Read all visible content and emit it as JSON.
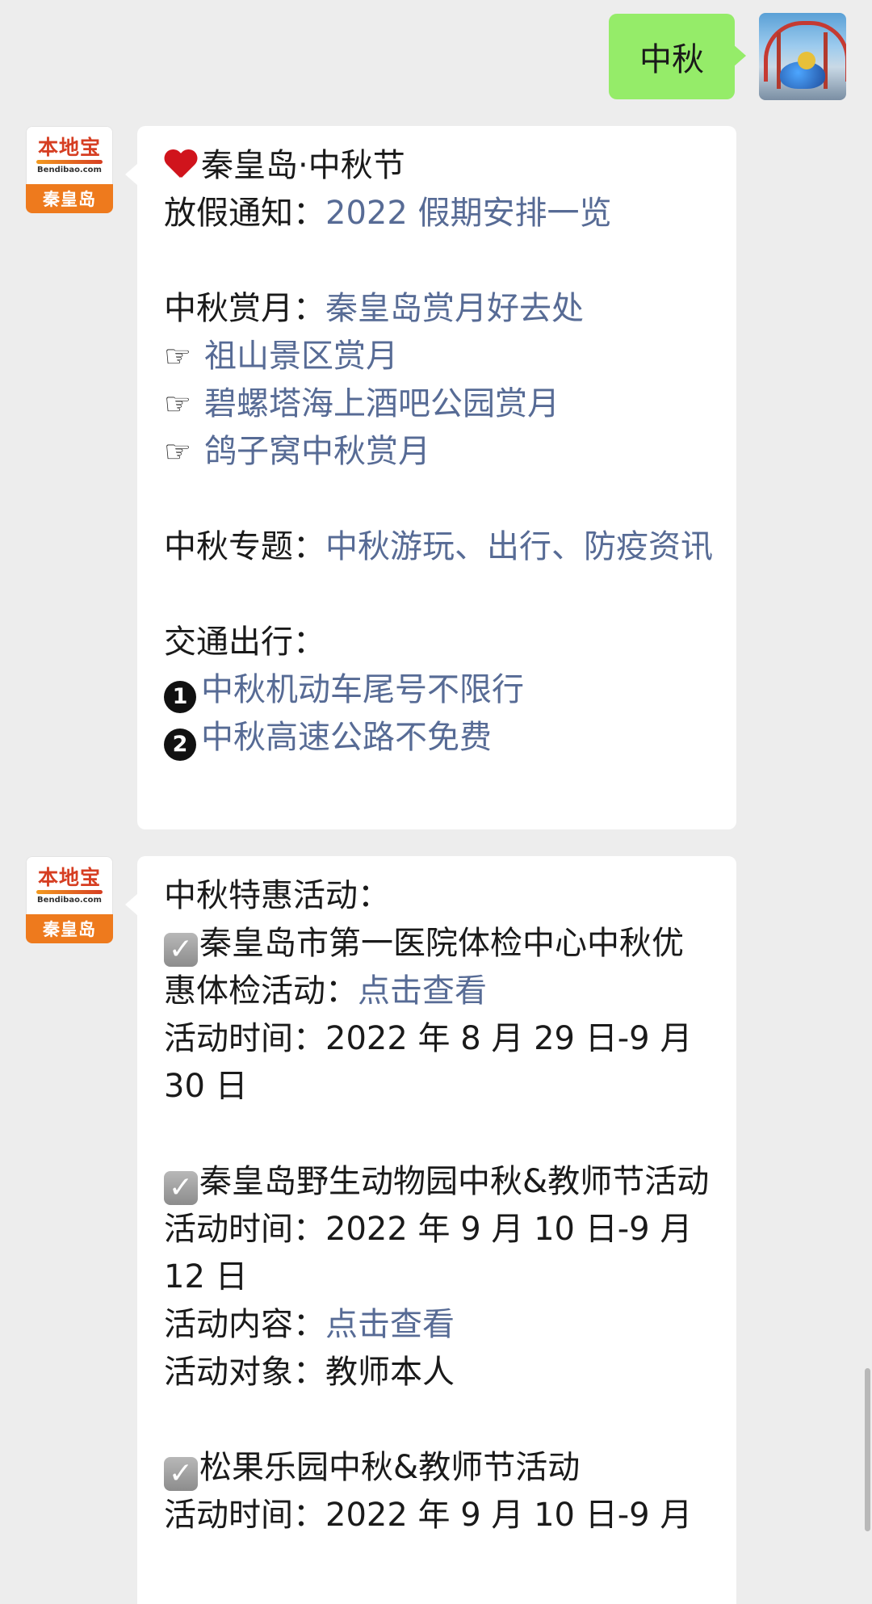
{
  "outgoing": {
    "text": "中秋"
  },
  "sender": {
    "logo_cn": "本地宝",
    "logo_en": "Bendibao.com",
    "logo_city": "秦皇岛"
  },
  "message1": {
    "title": "秦皇岛·中秋节",
    "holiday_label": "放假通知：",
    "holiday_link": "2022 假期安排一览",
    "moon_label": "中秋赏月：",
    "moon_link": "秦皇岛赏月好去处",
    "pointer_glyph": "☞",
    "moon_spots": [
      "祖山景区赏月",
      "碧螺塔海上酒吧公园赏月",
      "鸽子窝中秋赏月"
    ],
    "topic_label": "中秋专题：",
    "topic_link": "中秋游玩、出行、防疫资讯",
    "traffic_label": "交通出行：",
    "traffic_items": [
      {
        "num": "1",
        "text": "中秋机动车尾号不限行"
      },
      {
        "num": "2",
        "text": "中秋高速公路不免费"
      }
    ]
  },
  "message2": {
    "heading": "中秋特惠活动：",
    "check_glyph": "✓",
    "a1_title": "秦皇岛市第一医院体检中心中秋优惠体检活动：",
    "a1_link": "点击查看",
    "a1_time": "活动时间：2022 年 8 月 29 日-9 月 30 日",
    "a2_title": "秦皇岛野生动物园中秋&教师节活动",
    "a2_time": "活动时间：2022 年 9 月 10 日-9 月 12 日",
    "a2_content_label": "活动内容：",
    "a2_content_link": "点击查看",
    "a2_target": "活动对象：教师本人",
    "a3_title": "松果乐园中秋&教师节活动",
    "a3_time": "活动时间：2022 年 9 月 10 日-9 月"
  }
}
